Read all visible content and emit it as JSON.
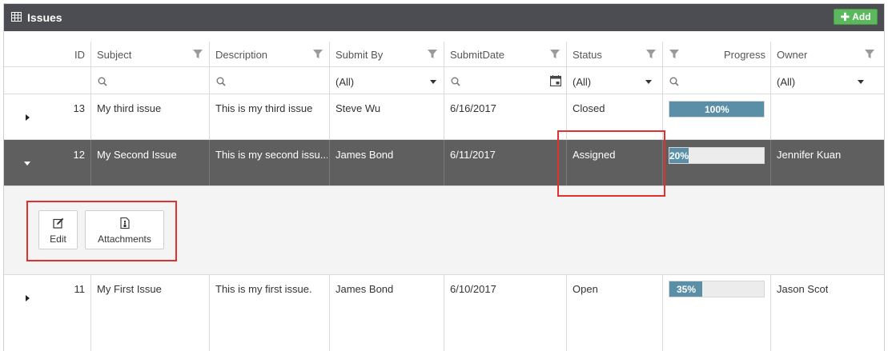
{
  "panel": {
    "title": "Issues",
    "add_label": "Add"
  },
  "columns": {
    "id": "ID",
    "subject": "Subject",
    "description": "Description",
    "submit_by": "Submit By",
    "submit_date": "SubmitDate",
    "status": "Status",
    "progress": "Progress",
    "owner": "Owner"
  },
  "filters": {
    "submit_by": "(All)",
    "status": "(All)",
    "owner": "(All)"
  },
  "rows": [
    {
      "id": "13",
      "subject": "My third issue",
      "description": "This is my third issue",
      "submit_by": "Steve Wu",
      "submit_date": "6/16/2017",
      "status": "Closed",
      "progress": 100,
      "progress_label": "100%",
      "owner": ""
    },
    {
      "id": "12",
      "subject": "My Second Issue",
      "description": "This is my second issu...",
      "submit_by": "James Bond",
      "submit_date": "6/11/2017",
      "status": "Assigned",
      "progress": 20,
      "progress_label": "20%",
      "owner": "Jennifer Kuan"
    },
    {
      "id": "11",
      "subject": "My First Issue",
      "description": "This is my first issue.",
      "submit_by": "James Bond",
      "submit_date": "6/10/2017",
      "status": "Open",
      "progress": 35,
      "progress_label": "35%",
      "owner": "Jason Scot"
    }
  ],
  "detail": {
    "edit_label": "Edit",
    "attachments_label": "Attachments"
  },
  "colors": {
    "header_bg": "#4b4d52",
    "add_button": "#5cb85c",
    "selected_row": "#5f5f5f",
    "progress_fill": "#5b8fa8",
    "highlight": "#e03030"
  }
}
